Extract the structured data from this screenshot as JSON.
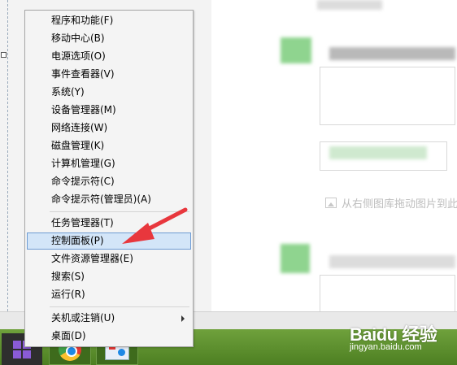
{
  "context_menu": {
    "items": [
      {
        "label": "程序和功能(F)"
      },
      {
        "label": "移动中心(B)"
      },
      {
        "label": "电源选项(O)"
      },
      {
        "label": "事件查看器(V)"
      },
      {
        "label": "系统(Y)"
      },
      {
        "label": "设备管理器(M)"
      },
      {
        "label": "网络连接(W)"
      },
      {
        "label": "磁盘管理(K)"
      },
      {
        "label": "计算机管理(G)"
      },
      {
        "label": "命令提示符(C)"
      },
      {
        "label": "命令提示符(管理员)(A)"
      },
      {
        "label": "任务管理器(T)"
      },
      {
        "label": "控制面板(P)",
        "highlighted": true
      },
      {
        "label": "文件资源管理器(E)"
      },
      {
        "label": "搜索(S)"
      },
      {
        "label": "运行(R)"
      },
      {
        "label": "关机或注销(U)",
        "has_submenu": true
      },
      {
        "label": "桌面(D)"
      }
    ]
  },
  "background": {
    "hint_text": "从右侧图库拖动图片到此"
  },
  "taskbar": {
    "start_icon": "windows-logo-icon",
    "apps": [
      "chrome-icon",
      "paint-icon"
    ]
  },
  "watermark": {
    "brand": "Baidu 经验",
    "url": "jingyan.baidu.com"
  },
  "annotation": {
    "arrow_color": "#e8373d",
    "points_to": "控制面板(P)"
  },
  "colors": {
    "highlight_bg": "#d3e5f8",
    "highlight_border": "#6d9bd3",
    "taskbar_green": "#5a8c2a",
    "start_purple": "#8a5bd6"
  }
}
